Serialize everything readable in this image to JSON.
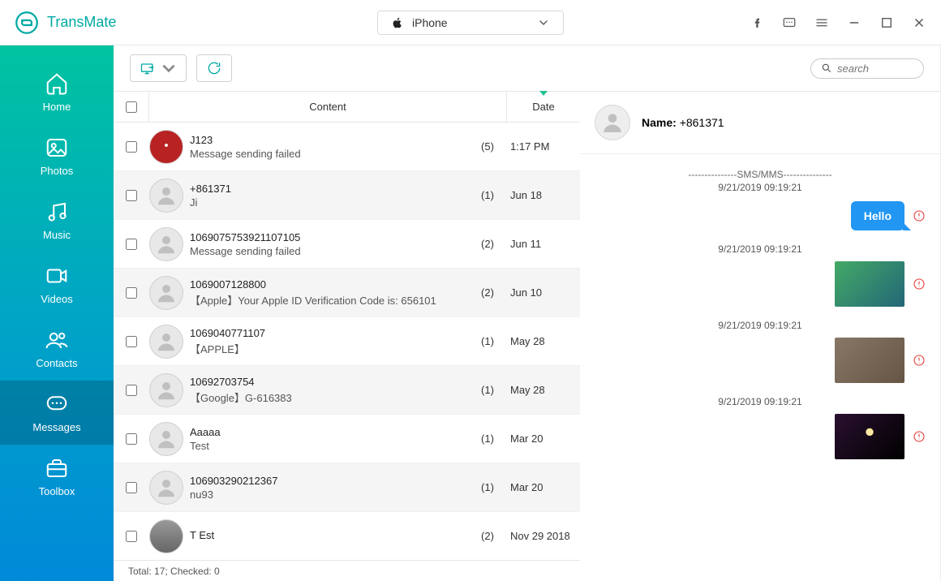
{
  "app": {
    "name": "TransMate"
  },
  "device": {
    "name": "iPhone"
  },
  "search": {
    "placeholder": "search"
  },
  "sidebar": {
    "items": [
      {
        "key": "home",
        "label": "Home"
      },
      {
        "key": "photos",
        "label": "Photos"
      },
      {
        "key": "music",
        "label": "Music"
      },
      {
        "key": "videos",
        "label": "Videos"
      },
      {
        "key": "contacts",
        "label": "Contacts"
      },
      {
        "key": "messages",
        "label": "Messages"
      },
      {
        "key": "toolbox",
        "label": "Toolbox"
      }
    ],
    "active": "messages"
  },
  "columns": {
    "content": "Content",
    "date": "Date"
  },
  "rows": [
    {
      "title": "J123",
      "sub": "Message sending failed",
      "count": "(5)",
      "date": "1:17 PM",
      "avatar": "red"
    },
    {
      "title": "+861371",
      "sub": "Ji",
      "count": "(1)",
      "date": "Jun 18",
      "avatar": "person",
      "alt": true
    },
    {
      "title": "1069075753921107105",
      "sub": "Message sending failed",
      "count": "(2)",
      "date": "Jun 11",
      "avatar": "person"
    },
    {
      "title": "1069007128800",
      "sub": "【Apple】Your Apple ID Verification Code is: 656101",
      "count": "(2)",
      "date": "Jun 10",
      "avatar": "person",
      "alt": true
    },
    {
      "title": "1069040771107",
      "sub": "【APPLE】",
      "count": "(1)",
      "date": "May 28",
      "avatar": "person"
    },
    {
      "title": "10692703754",
      "sub": "【Google】G-616383",
      "count": "(1)",
      "date": "May 28",
      "avatar": "person",
      "alt": true
    },
    {
      "title": "Aaaaa",
      "sub": "Test",
      "count": "(1)",
      "date": "Mar 20",
      "avatar": "person"
    },
    {
      "title": "106903290212367",
      "sub": "nu93",
      "count": "(1)",
      "date": "Mar 20",
      "avatar": "person",
      "alt": true
    },
    {
      "title": "T Est",
      "sub": "",
      "count": "(2)",
      "date": "Nov 29 2018",
      "avatar": "photo"
    }
  ],
  "status": {
    "text": "Total: 17; Checked: 0"
  },
  "detail": {
    "name_label": "Name:",
    "name_value": "+861371",
    "separator": "---------------SMS/MMS---------------",
    "timestamps": [
      "9/21/2019 09:19:21",
      "9/21/2019 09:19:21",
      "9/21/2019 09:19:21",
      "9/21/2019 09:19:21"
    ],
    "bubble_text": "Hello"
  }
}
